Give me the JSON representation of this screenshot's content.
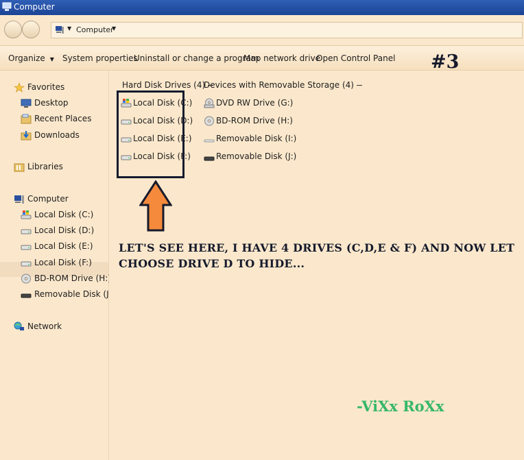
{
  "window": {
    "title": "Computer"
  },
  "address": {
    "path": "Computer"
  },
  "toolbar": {
    "organize": "Organize",
    "system_properties": "System properties",
    "uninstall": "Uninstall or change a program",
    "map_drive": "Map network drive",
    "control_panel": "Open Control Panel"
  },
  "step_badge": "#3",
  "sidebar": {
    "favorites": "Favorites",
    "desktop": "Desktop",
    "recent_places": "Recent Places",
    "downloads": "Downloads",
    "libraries": "Libraries",
    "computer": "Computer",
    "drives": [
      "Local Disk (C:)",
      "Local Disk (D:)",
      "Local Disk (E:)",
      "Local Disk (F:)",
      "BD-ROM Drive (H:)",
      "Removable Disk (J:)"
    ],
    "network": "Network"
  },
  "groups": {
    "hard_disks": {
      "header": "Hard Disk Drives (4)",
      "items": [
        "Local Disk (C:)",
        "Local Disk (D:)",
        "Local Disk (E:)",
        "Local Disk (F:)"
      ]
    },
    "removable": {
      "header": "Devices with Removable Storage (4)",
      "items": [
        "DVD RW Drive (G:)",
        "BD-ROM Drive (H:)",
        "Removable Disk (I:)",
        "Removable Disk (J:)"
      ]
    }
  },
  "annotation": {
    "line1": "LET'S SEE HERE, I HAVE 4 DRIVES (C,D,E & F) AND NOW LET",
    "line2": "CHOOSE DRIVE D TO HIDE..."
  },
  "signature": "-ViXx RoXx",
  "colors": {
    "titlebar": "#1c4496",
    "background": "#fbe8cc",
    "annotation": "#161a2c",
    "arrow": "#f58a3c",
    "signature": "#35b768"
  }
}
